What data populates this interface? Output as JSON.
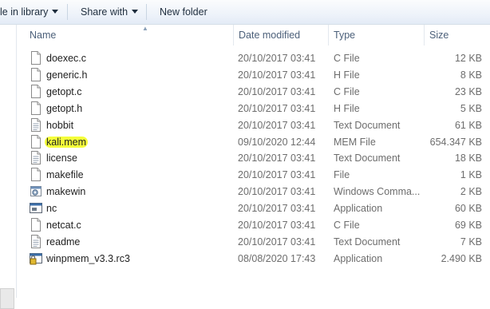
{
  "toolbar": {
    "include_label": "le in library",
    "share_label": "Share with",
    "newfolder_label": "New folder"
  },
  "columns": {
    "name": "Name",
    "date": "Date modified",
    "type": "Type",
    "size": "Size"
  },
  "files": [
    {
      "name": "doexec.c",
      "date": "20/10/2017 03:41",
      "type": "C File",
      "size": "12 KB",
      "icon": "file-icon"
    },
    {
      "name": "generic.h",
      "date": "20/10/2017 03:41",
      "type": "H File",
      "size": "8 KB",
      "icon": "file-icon"
    },
    {
      "name": "getopt.c",
      "date": "20/10/2017 03:41",
      "type": "C File",
      "size": "23 KB",
      "icon": "file-icon"
    },
    {
      "name": "getopt.h",
      "date": "20/10/2017 03:41",
      "type": "H File",
      "size": "5 KB",
      "icon": "file-icon"
    },
    {
      "name": "hobbit",
      "date": "20/10/2017 03:41",
      "type": "Text Document",
      "size": "61 KB",
      "icon": "text-document-icon"
    },
    {
      "name": "kali.mem",
      "date": "09/10/2020 12:44",
      "type": "MEM File",
      "size": "654.347 KB",
      "icon": "file-icon",
      "highlighted": true
    },
    {
      "name": "license",
      "date": "20/10/2017 03:41",
      "type": "Text Document",
      "size": "18 KB",
      "icon": "text-document-icon"
    },
    {
      "name": "makefile",
      "date": "20/10/2017 03:41",
      "type": "File",
      "size": "1 KB",
      "icon": "file-icon"
    },
    {
      "name": "makewin",
      "date": "20/10/2017 03:41",
      "type": "Windows Comma...",
      "size": "2 KB",
      "icon": "batch-file-icon"
    },
    {
      "name": "nc",
      "date": "20/10/2017 03:41",
      "type": "Application",
      "size": "60 KB",
      "icon": "application-icon"
    },
    {
      "name": "netcat.c",
      "date": "20/10/2017 03:41",
      "type": "C File",
      "size": "69 KB",
      "icon": "file-icon"
    },
    {
      "name": "readme",
      "date": "20/10/2017 03:41",
      "type": "Text Document",
      "size": "7 KB",
      "icon": "text-document-icon"
    },
    {
      "name": "winpmem_v3.3.rc3",
      "date": "08/08/2020 17:43",
      "type": "Application",
      "size": "2.490 KB",
      "icon": "application-icon"
    }
  ],
  "colors": {
    "highlight": "#f4ff3a",
    "toolbar_bg": "#eef3fa",
    "header_text": "#4c607a",
    "secondary_text": "#6d6d6d"
  }
}
